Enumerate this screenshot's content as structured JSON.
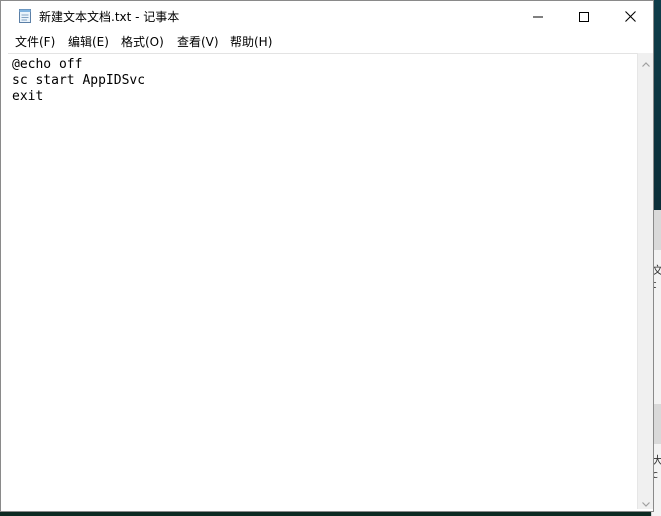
{
  "window": {
    "title": "新建文本文档.txt - 记事本"
  },
  "menu": {
    "file": "文件(F)",
    "edit": "编辑(E)",
    "format": "格式(O)",
    "view": "查看(V)",
    "help": "帮助(H)"
  },
  "editor": {
    "content": "@echo off\nsc start AppIDSvc\nexit"
  },
  "background_peek": {
    "char_1": "文",
    "char_2": "t",
    "char_3": "大",
    "char_4": "c"
  },
  "icons": {
    "app": "notepad-icon",
    "minimize": "minimize-icon",
    "maximize": "maximize-icon",
    "close": "close-icon",
    "scroll_up": "chevron-up-icon",
    "scroll_down": "chevron-down-icon"
  }
}
